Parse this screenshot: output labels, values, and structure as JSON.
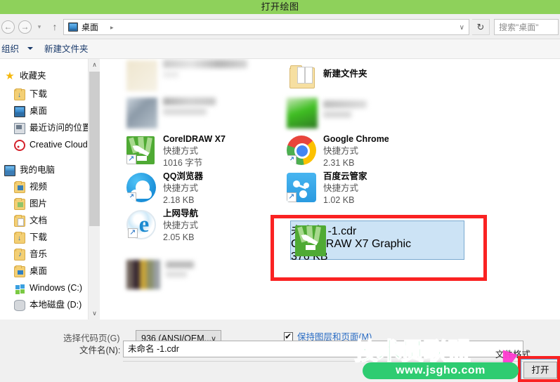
{
  "window": {
    "title": "打开绘图"
  },
  "nav": {
    "back_icon": "arrow-left-icon",
    "forward_icon": "arrow-right-icon",
    "history_icon": "chevron-down-icon",
    "up_icon": "arrow-up-icon",
    "address_value": "桌面",
    "address_separator": "▸",
    "address_chevron": "∨",
    "refresh_icon": "↻",
    "search_placeholder": "搜索\"桌面\""
  },
  "toolbar": {
    "organize_label": "组织",
    "new_folder_label": "新建文件夹"
  },
  "sidebar": {
    "items": [
      {
        "label": "收藏夹",
        "icon": "star-icon",
        "level": 0
      },
      {
        "label": "下载",
        "icon": "download-folder-icon",
        "level": 1
      },
      {
        "label": "桌面",
        "icon": "desktop-monitor-icon",
        "level": 1
      },
      {
        "label": "最近访问的位置",
        "icon": "recent-places-icon",
        "level": 1
      },
      {
        "label": "Creative Cloud",
        "icon": "creative-cloud-icon",
        "level": 1
      },
      {
        "label": "我的电脑",
        "icon": "my-computer-icon",
        "level": 0
      },
      {
        "label": "视频",
        "icon": "video-folder-icon",
        "level": 1
      },
      {
        "label": "图片",
        "icon": "pictures-folder-icon",
        "level": 1
      },
      {
        "label": "文档",
        "icon": "documents-folder-icon",
        "level": 1
      },
      {
        "label": "下载",
        "icon": "download-folder-icon",
        "level": 1
      },
      {
        "label": "音乐",
        "icon": "music-folder-icon",
        "level": 1
      },
      {
        "label": "桌面",
        "icon": "desktop-folder-icon",
        "level": 1
      },
      {
        "label": "Windows (C:)",
        "icon": "windows-drive-icon",
        "level": 1
      },
      {
        "label": "本地磁盘 (D:)",
        "icon": "local-disk-icon",
        "level": 1
      }
    ],
    "scroll_up_icon": "∧",
    "scroll_down_icon": "∨"
  },
  "files": {
    "new_folder": {
      "name": "新建文件夹",
      "type": "",
      "size": ""
    },
    "coreldraw": {
      "name": "CorelDRAW X7",
      "type": "快捷方式",
      "size": "1016 字节"
    },
    "chrome": {
      "name": "Google Chrome",
      "type": "快捷方式",
      "size": "2.31 KB"
    },
    "qq": {
      "name": "QQ浏览器",
      "type": "快捷方式",
      "size": "2.18 KB"
    },
    "baidu": {
      "name": "百度云管家",
      "type": "快捷方式",
      "size": "1.02 KB"
    },
    "ie": {
      "name": "上网导航",
      "type": "快捷方式",
      "size": "2.05 KB"
    },
    "selected": {
      "name": "未命名 -1.cdr",
      "type": "CorelDRAW X7 Graphic",
      "size": "376 KB"
    }
  },
  "bottom": {
    "codepage_label": "选择代码页(G)",
    "codepage_value": "936   (ANSI/OEM...",
    "codepage_chevron": "∨",
    "keep_layers_label": "保持图层和页面(M)",
    "filename_label": "文件名(N):",
    "filename_value": "未命名 -1.cdr",
    "file_format_label": "文件格式",
    "open_button_label": "打开"
  },
  "watermark": {
    "brand": "技术员联盟",
    "url": "www.jsgho.com"
  },
  "colors": {
    "titlebar_green": "#8ed15b",
    "highlight_red": "#fa2222",
    "selection_blue": "#cce3f5",
    "watermark_green": "#2ecc71",
    "link_blue": "#2a6cc4"
  }
}
